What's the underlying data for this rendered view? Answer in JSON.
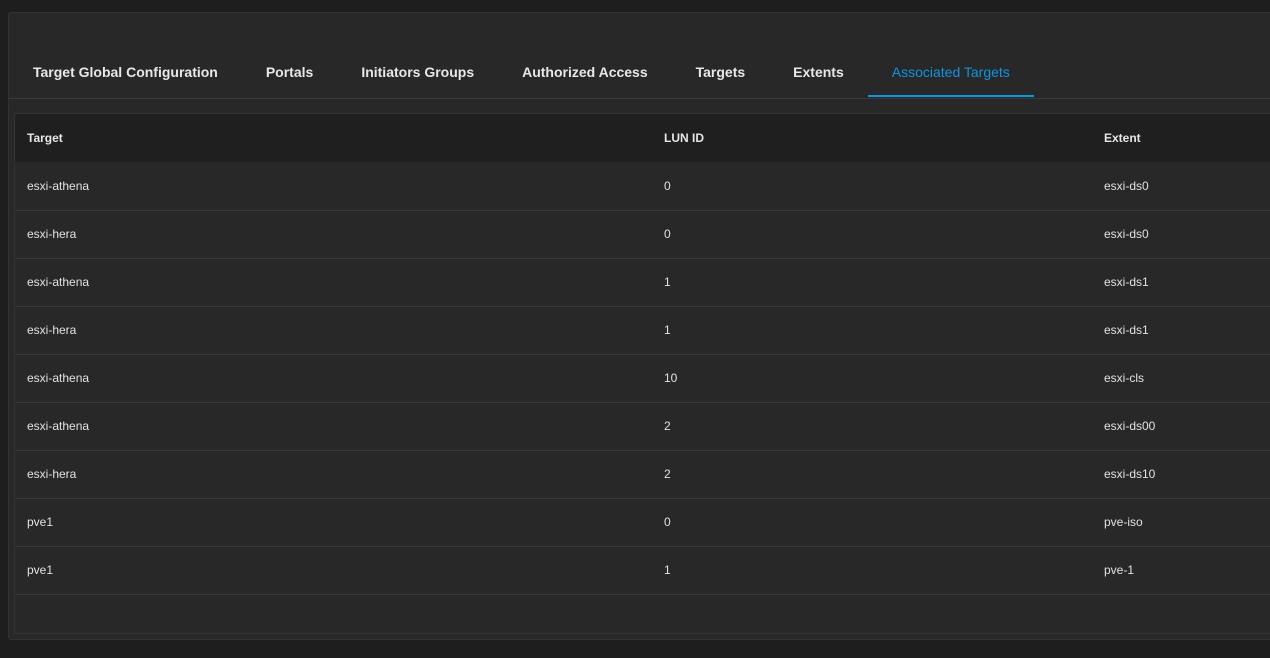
{
  "tabs": [
    {
      "label": "Target Global Configuration",
      "active": false
    },
    {
      "label": "Portals",
      "active": false
    },
    {
      "label": "Initiators Groups",
      "active": false
    },
    {
      "label": "Authorized Access",
      "active": false
    },
    {
      "label": "Targets",
      "active": false
    },
    {
      "label": "Extents",
      "active": false
    },
    {
      "label": "Associated Targets",
      "active": true
    }
  ],
  "colors": {
    "accent": "#0d95e1",
    "background": "#1e1e1e",
    "panel": "#282828"
  },
  "table": {
    "headers": {
      "target": "Target",
      "lun_id": "LUN ID",
      "extent": "Extent"
    },
    "rows": [
      {
        "target": "esxi-athena",
        "lun_id": "0",
        "extent": "esxi-ds0"
      },
      {
        "target": "esxi-hera",
        "lun_id": "0",
        "extent": "esxi-ds0"
      },
      {
        "target": "esxi-athena",
        "lun_id": "1",
        "extent": "esxi-ds1"
      },
      {
        "target": "esxi-hera",
        "lun_id": "1",
        "extent": "esxi-ds1"
      },
      {
        "target": "esxi-athena",
        "lun_id": "10",
        "extent": "esxi-cls"
      },
      {
        "target": "esxi-athena",
        "lun_id": "2",
        "extent": "esxi-ds00"
      },
      {
        "target": "esxi-hera",
        "lun_id": "2",
        "extent": "esxi-ds10"
      },
      {
        "target": "pve1",
        "lun_id": "0",
        "extent": "pve-iso"
      },
      {
        "target": "pve1",
        "lun_id": "1",
        "extent": "pve-1"
      }
    ]
  }
}
